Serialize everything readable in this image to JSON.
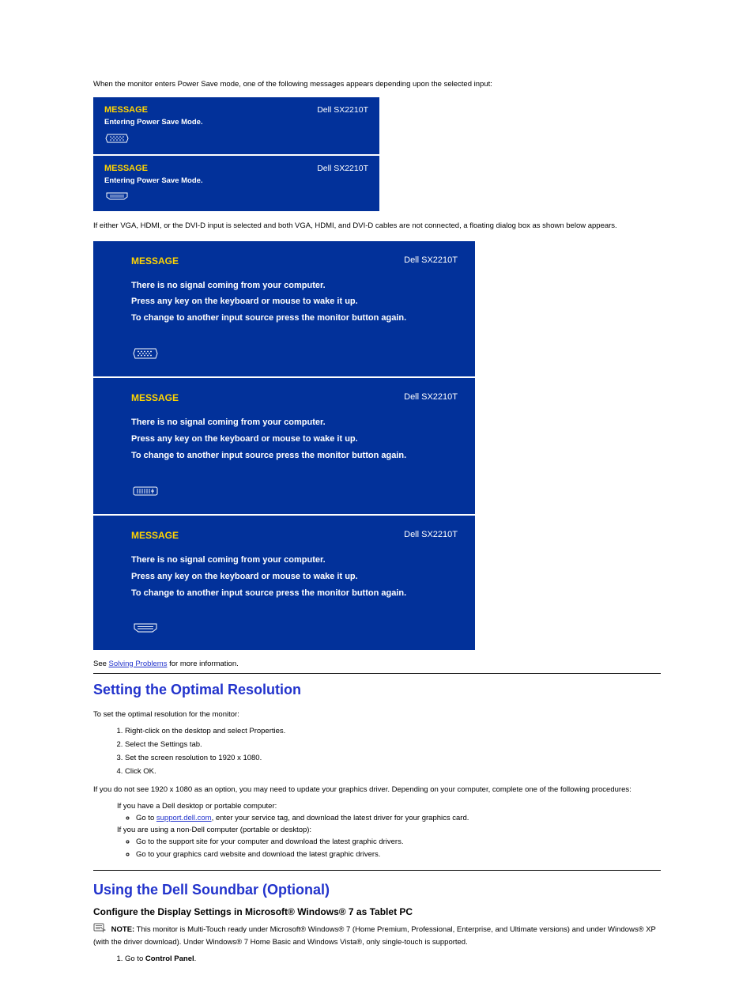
{
  "intro": "When the monitor enters Power Save mode, one of the following messages appears depending upon the selected input:",
  "model": "Dell SX2210T",
  "msg_title": "MESSAGE",
  "psm_body": "Entering Power Save Mode.",
  "mid": "If either VGA, HDMI, or the DVI-D input is selected and both VGA, HDMI, and DVI-D cables are not connected, a floating dialog box as shown below appears.",
  "nosig": {
    "l1": "There is no signal coming from your computer.",
    "l2": "Press any key on the keyboard or mouse to wake it up.",
    "l3": "To change to another input source press the monitor button again."
  },
  "see_prefix": "See ",
  "see_link": "Solving Problems",
  "see_suffix": " for more information.",
  "optres": {
    "title": "Setting the Optimal Resolution",
    "para": "To set the optimal resolution for the monitor:",
    "steps": {
      "s1": "Right-click on the desktop and select Properties.",
      "s2": "Select the Settings tab.",
      "s3": "Set the screen resolution to 1920 x 1080.",
      "s4": "Click OK."
    },
    "note": "If you do not see 1920 x 1080 as an option, you may need to update your graphics driver. Depending on your computer, complete one of the following procedures:",
    "bul": {
      "b1_pre": "If you have a Dell desktop or portable computer:",
      "b1_sub_pre": "Go to ",
      "b1_sub_link": "support.dell.com",
      "b1_sub_post": ", enter your service tag, and download the latest driver for your graphics card.",
      "b2_pre": "If you are using a non-Dell computer (portable or desktop):",
      "b2_sub1": "Go to the support site for your computer and download the latest graphic drivers.",
      "b2_sub2": "Go to your graphics card website and download the latest graphic drivers."
    }
  },
  "touch": {
    "title": "Using the Dell Soundbar (Optional)",
    "sub": "Configure the Display Settings in Microsoft® Windows® 7 as Tablet PC",
    "note_label": "NOTE:",
    "note_body": "This monitor is Multi-Touch ready under Microsoft® Windows® 7 (Home Premium, Professional, Enterprise, and Ultimate versions) and under Windows® XP (with the driver download). Under Windows® 7 Home Basic and Windows Vista®, only single-touch is supported.",
    "steps": {
      "s1_pre": "Go to ",
      "s1_bold": "Control Panel",
      "s1_post": "."
    }
  }
}
